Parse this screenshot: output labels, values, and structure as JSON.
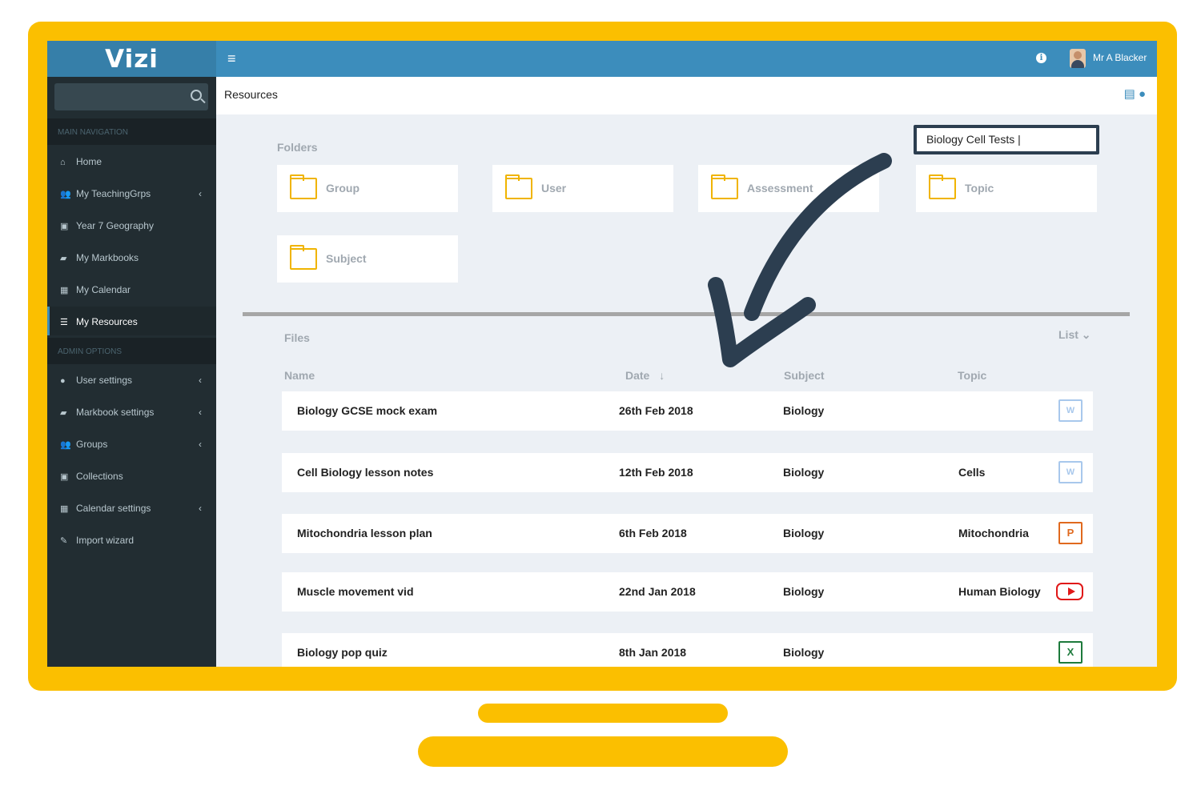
{
  "app": {
    "logo": "Vizi"
  },
  "topbar": {
    "menu_icon": "hamburger-icon",
    "info_icon": "info-icon",
    "user_name": "Mr A Blacker"
  },
  "sidebar": {
    "search_placeholder": "",
    "main_nav_header": "MAIN NAVIGATION",
    "admin_header": "ADMIN OPTIONS",
    "items": [
      {
        "label": "Home",
        "icon": "home-icon",
        "glyph": "⌂",
        "has_chevron": false
      },
      {
        "label": "My TeachingGrps",
        "icon": "users-icon",
        "glyph": "👥",
        "has_chevron": true
      },
      {
        "label": "Year 7 Geography",
        "icon": "image-icon",
        "glyph": "▣",
        "has_chevron": false
      },
      {
        "label": "My Markbooks",
        "icon": "book-icon",
        "glyph": "▰",
        "has_chevron": false
      },
      {
        "label": "My Calendar",
        "icon": "calendar-icon",
        "glyph": "▦",
        "has_chevron": false
      },
      {
        "label": "My Resources",
        "icon": "resources-icon",
        "glyph": "☰",
        "has_chevron": false,
        "active": true
      }
    ],
    "admin_items": [
      {
        "label": "User settings",
        "icon": "user-icon",
        "glyph": "●",
        "has_chevron": true
      },
      {
        "label": "Markbook settings",
        "icon": "book-icon",
        "glyph": "▰",
        "has_chevron": true
      },
      {
        "label": "Groups",
        "icon": "users-icon",
        "glyph": "👥",
        "has_chevron": true
      },
      {
        "label": "Collections",
        "icon": "image-icon",
        "glyph": "▣",
        "has_chevron": false
      },
      {
        "label": "Calendar settings",
        "icon": "calendar-icon",
        "glyph": "▦",
        "has_chevron": true
      },
      {
        "label": "Import wizard",
        "icon": "wand-icon",
        "glyph": "✎",
        "has_chevron": false
      }
    ]
  },
  "header": {
    "title": "Resources",
    "icons": [
      "book-icon",
      "comment-icon"
    ]
  },
  "search": {
    "value": "Biology Cell Tests |"
  },
  "folders": {
    "label": "Folders",
    "items": [
      "Group",
      "User",
      "Assessment",
      "Topic",
      "Subject"
    ]
  },
  "files": {
    "label": "Files",
    "view_toggle": "List",
    "columns": {
      "name": "Name",
      "date": "Date",
      "subject": "Subject",
      "topic": "Topic"
    },
    "sort": "date-descending",
    "rows": [
      {
        "name": "Biology GCSE mock exam",
        "date": "26th Feb 2018",
        "subject": "Biology",
        "topic": "",
        "type": "word"
      },
      {
        "name": "Cell Biology lesson notes",
        "date": "12th Feb 2018",
        "subject": "Biology",
        "topic": "Cells",
        "type": "word"
      },
      {
        "name": "Mitochondria lesson plan",
        "date": "6th Feb 2018",
        "subject": "Biology",
        "topic": "Mitochondria",
        "type": "powerpoint"
      },
      {
        "name": "Muscle movement vid",
        "date": "22nd Jan 2018",
        "subject": "Biology",
        "topic": "Human Biology",
        "type": "youtube"
      },
      {
        "name": "Biology pop quiz",
        "date": "8th Jan 2018",
        "subject": "Biology",
        "topic": "",
        "type": "excel"
      }
    ]
  },
  "colors": {
    "frame": "#fbbf00",
    "topbar": "#3c8dbc",
    "sidebar": "#222d32",
    "annotation_arrow": "#2c3e50"
  }
}
